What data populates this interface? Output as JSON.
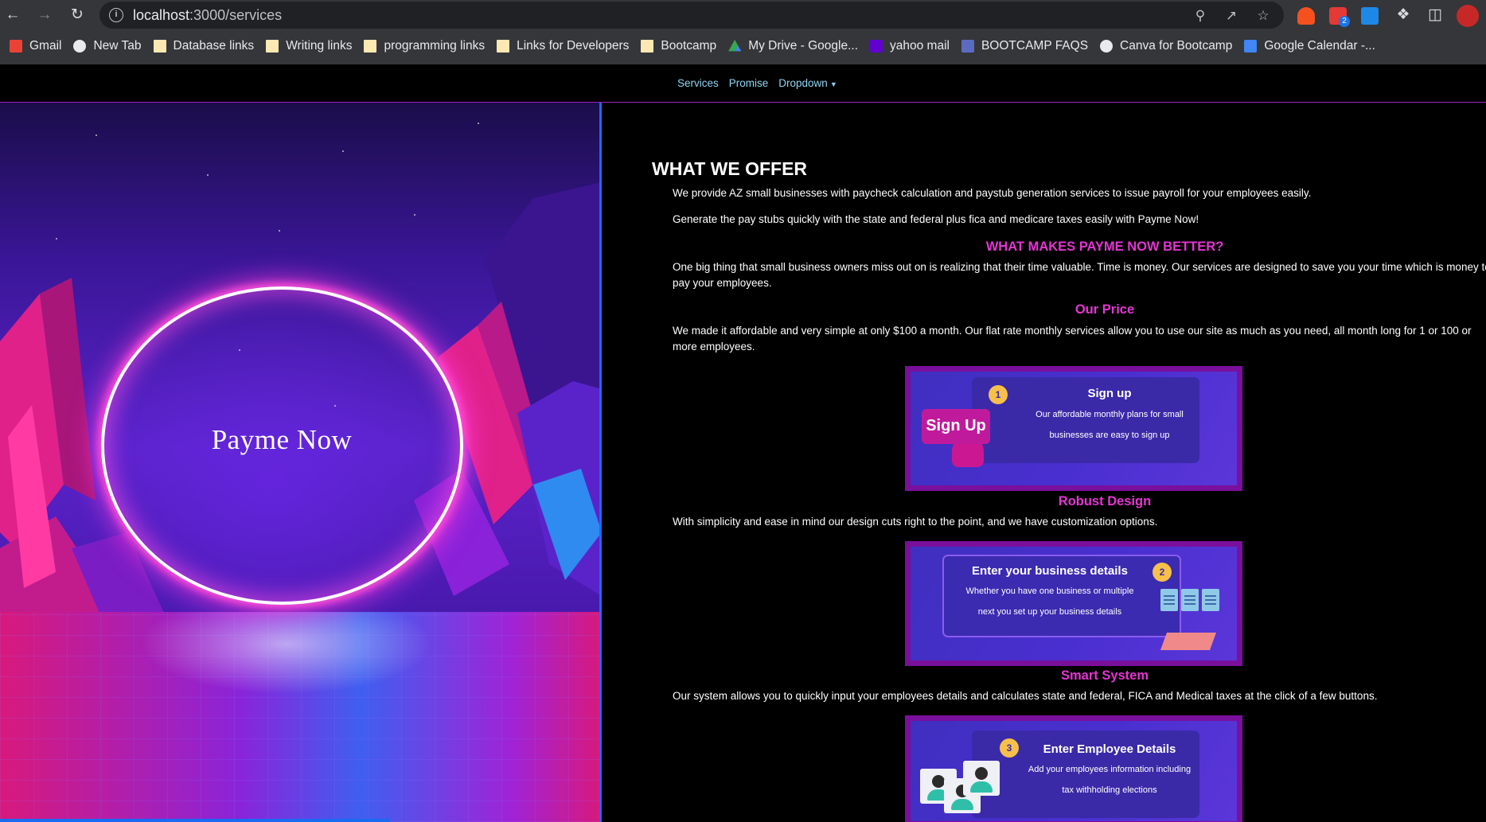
{
  "browser": {
    "url_host": "localhost",
    "url_rest": ":3000/services",
    "bookmarks": [
      {
        "label": "Gmail",
        "icon": "gmail-icon",
        "color": "#ea4335"
      },
      {
        "label": "New Tab",
        "icon": "globe-icon",
        "color": "#e8eaed"
      },
      {
        "label": "Database links",
        "icon": "folder-icon",
        "color": "#fce8b2"
      },
      {
        "label": "Writing links",
        "icon": "folder-icon",
        "color": "#fce8b2"
      },
      {
        "label": "programming links",
        "icon": "folder-icon",
        "color": "#fce8b2"
      },
      {
        "label": "Links for Developers",
        "icon": "folder-icon",
        "color": "#fce8b2"
      },
      {
        "label": "Bootcamp",
        "icon": "folder-icon",
        "color": "#fce8b2"
      },
      {
        "label": "My Drive - Google...",
        "icon": "drive-icon",
        "color": "#34a853"
      },
      {
        "label": "yahoo mail",
        "icon": "yahoo-icon",
        "color": "#6001d2"
      },
      {
        "label": "BOOTCAMP FAQS",
        "icon": "forms-icon",
        "color": "#5c6bc0"
      },
      {
        "label": "Canva for Bootcamp",
        "icon": "globe-icon",
        "color": "#e8eaed"
      },
      {
        "label": "Google Calendar -...",
        "icon": "calendar-icon",
        "color": "#4285f4"
      }
    ],
    "extension_badge": "2"
  },
  "navbar": {
    "links": [
      "Services",
      "Promise",
      "Dropdown"
    ],
    "link_color": "#8fd4f2"
  },
  "hero": {
    "title": "Payme Now"
  },
  "content": {
    "title": "WHAT WE OFFER",
    "intro_1": "We provide AZ small businesses with paycheck calculation and paystub generation services to issue payroll for your employees easily.",
    "intro_2": "Generate the pay stubs quickly with the state and federal plus fica and medicare taxes easily with Payme Now!",
    "better_heading": "WHAT MAKES PAYME NOW BETTER?",
    "better_text": "One big thing that small business owners miss out on is realizing that their time valuable. Time is money. Our services are designed to save you your time which is money to pay your employees.",
    "price_heading": "Our Price",
    "price_text": "We made it affordable and very simple at only $100 a month. Our flat rate monthly services allow you to use our site as much as you need, all month long for 1 or 100 or more employees.",
    "design_heading": "Robust Design",
    "design_text": "With simplicity and ease in mind our design cuts right to the point, and we have customization options.",
    "system_heading": "Smart System",
    "system_text": "Our system allows you to quickly input your employees details and calculates state and federal, FICA and Medical taxes at the click of a few buttons.",
    "heading_color": "#e535d3"
  },
  "cards": [
    {
      "num": "1",
      "heading": "Sign up",
      "line1": "Our affordable monthly plans for small",
      "line2": "businesses are easy to sign up",
      "chip": "Sign Up"
    },
    {
      "num": "2",
      "heading": "Enter your business details",
      "line1": "Whether you have one business or multiple",
      "line2": "next you set up your business details"
    },
    {
      "num": "3",
      "heading": "Enter Employee Details",
      "line1": "Add your employees information including",
      "line2": "tax withholding elections"
    }
  ]
}
